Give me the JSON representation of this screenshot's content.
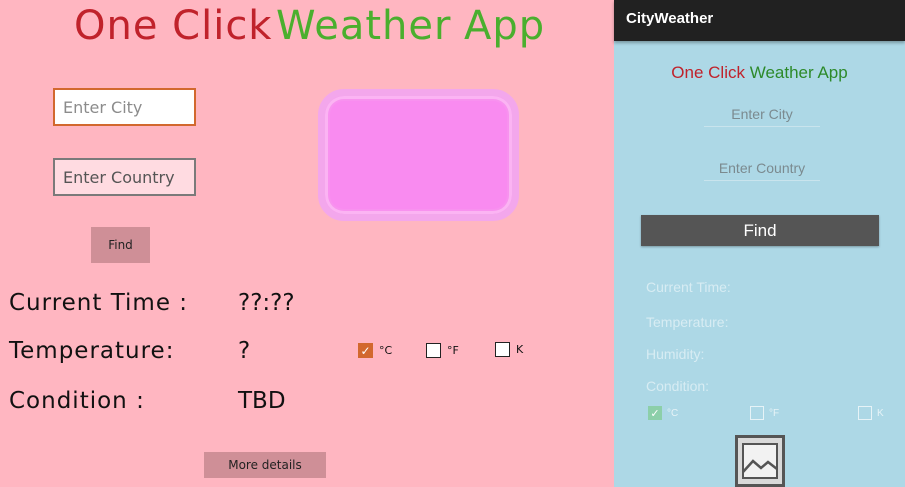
{
  "desktop": {
    "title": {
      "part1": "One Click",
      "part2": "Weather",
      "part3": "App"
    },
    "city_placeholder": "Enter City",
    "country_placeholder": "Enter Country",
    "find_label": "Find",
    "labels": {
      "time": "Current  Time :",
      "temperature": "Temperature:",
      "condition": "Condition  :"
    },
    "values": {
      "time": "??:??",
      "temperature": "?",
      "condition": "TBD"
    },
    "units": {
      "celsius": "°C",
      "fahrenheit": "°F",
      "kelvin": "K"
    },
    "unit_checked": {
      "celsius": true,
      "fahrenheit": false,
      "kelvin": false
    },
    "more_label": "More details",
    "colors": {
      "background": "#ffb6c1",
      "title_red": "#c0222b",
      "title_green": "#4aaf2e",
      "accent": "#d2682e",
      "image_fill": "#f98bf0"
    }
  },
  "phone": {
    "app_name": "CityWeather",
    "title": {
      "part1": "One Click",
      "part2": "Weather App"
    },
    "city_placeholder": "Enter City",
    "country_placeholder": "Enter Country",
    "find_label": "Find",
    "labels": {
      "time": "Current Time:",
      "temperature": "Temperature:",
      "humidity": "Humidity:",
      "condition": "Condition:"
    },
    "units": {
      "celsius": "°C",
      "fahrenheit": "°F",
      "kelvin": "K"
    },
    "unit_checked": {
      "celsius": true,
      "fahrenheit": false,
      "kelvin": false
    },
    "image_icon": "image-placeholder-icon",
    "colors": {
      "background": "#add8e6",
      "appbar": "#212121",
      "button": "#555555"
    }
  }
}
